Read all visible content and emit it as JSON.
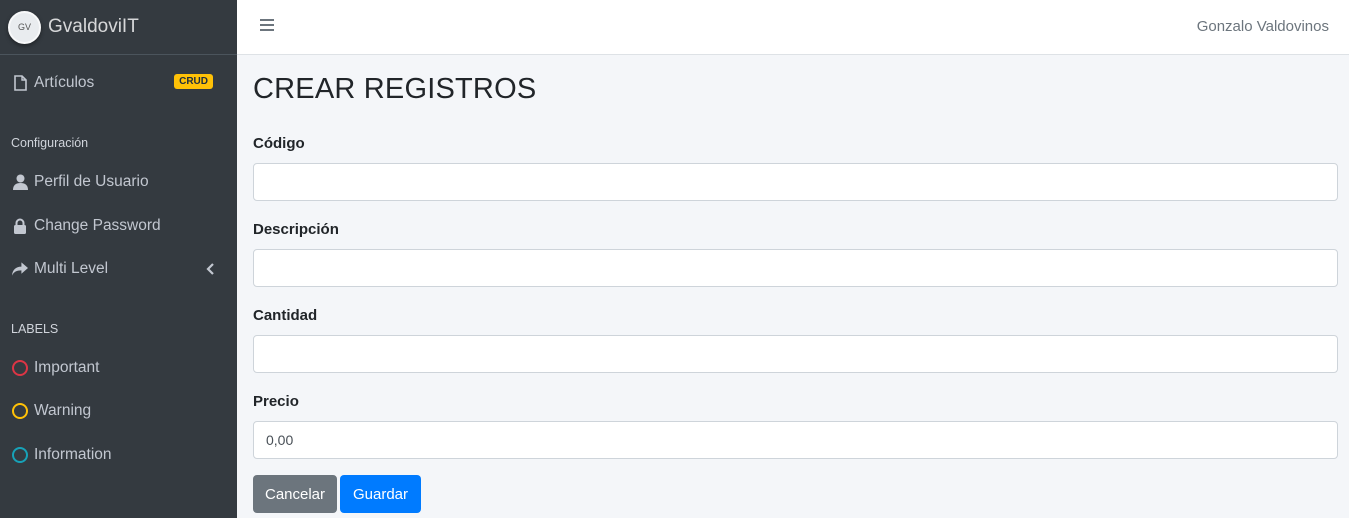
{
  "brand": {
    "logo_text": "GV",
    "name": "GvaldoviIT"
  },
  "sidebar": {
    "items": [
      {
        "label": "Artículos",
        "icon": "file-icon",
        "badge": "CRUD"
      }
    ],
    "config_header": "Configuración",
    "config_items": [
      {
        "label": "Perfil de Usuario",
        "icon": "user-icon"
      },
      {
        "label": "Change Password",
        "icon": "lock-icon"
      },
      {
        "label": "Multi Level",
        "icon": "share-icon"
      }
    ],
    "labels_header": "LABELS",
    "labels": [
      {
        "label": "Important",
        "color": "#dc3545"
      },
      {
        "label": "Warning",
        "color": "#ffc107"
      },
      {
        "label": "Information",
        "color": "#17a2b8"
      }
    ]
  },
  "topbar": {
    "user": "Gonzalo Valdovinos"
  },
  "main": {
    "title": "CREAR REGISTROS",
    "fields": [
      {
        "label": "Código",
        "value": ""
      },
      {
        "label": "Descripción",
        "value": ""
      },
      {
        "label": "Cantidad",
        "value": ""
      },
      {
        "label": "Precio",
        "value": "0,00"
      }
    ],
    "cancel_label": "Cancelar",
    "save_label": "Guardar"
  }
}
